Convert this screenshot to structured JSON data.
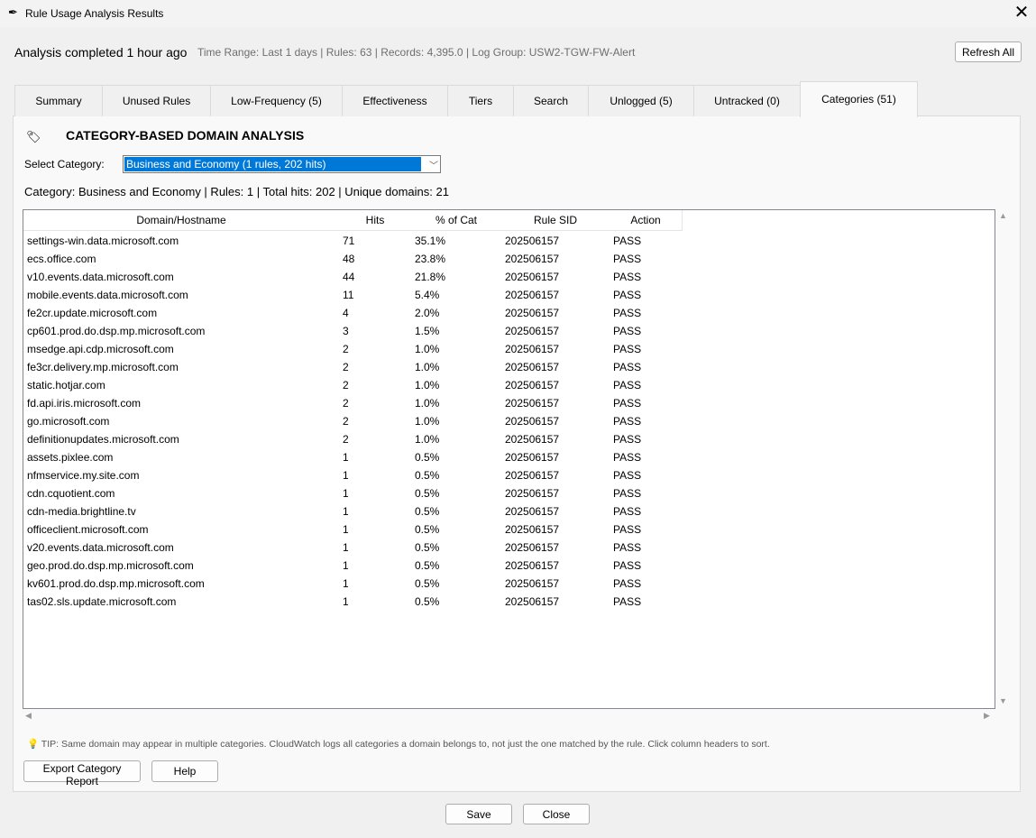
{
  "window": {
    "title": "Rule Usage Analysis Results",
    "app_icon": "feather-icon",
    "close_glyph": "✕"
  },
  "header": {
    "status": "Analysis completed 1 hour ago",
    "meta": "Time Range: Last 1 days | Rules: 63 | Records: 4,395.0 | Log Group: USW2-TGW-FW-Alert",
    "refresh_label": "Refresh All"
  },
  "tabs": [
    {
      "label": "Summary"
    },
    {
      "label": "Unused Rules"
    },
    {
      "label": "Low-Frequency (5)"
    },
    {
      "label": "Effectiveness"
    },
    {
      "label": "Tiers"
    },
    {
      "label": "Search"
    },
    {
      "label": "Unlogged (5)"
    },
    {
      "label": "Untracked (0)"
    },
    {
      "label": "Categories (51)"
    }
  ],
  "active_tab": "Categories (51)",
  "section": {
    "icon_glyph": "🏷",
    "title": "CATEGORY-BASED DOMAIN ANALYSIS",
    "select_label": "Select Category:",
    "select_value": "Business and Economy (1 rules, 202 hits)",
    "summary": "Category: Business and Economy  |  Rules: 1  |  Total hits: 202  |  Unique domains: 21"
  },
  "table": {
    "columns": [
      "Domain/Hostname",
      "Hits",
      "% of Cat",
      "Rule SID",
      "Action"
    ],
    "rows": [
      [
        "settings-win.data.microsoft.com",
        "71",
        "35.1%",
        "202506157",
        "PASS"
      ],
      [
        "ecs.office.com",
        "48",
        "23.8%",
        "202506157",
        "PASS"
      ],
      [
        "v10.events.data.microsoft.com",
        "44",
        "21.8%",
        "202506157",
        "PASS"
      ],
      [
        "mobile.events.data.microsoft.com",
        "11",
        "5.4%",
        "202506157",
        "PASS"
      ],
      [
        "fe2cr.update.microsoft.com",
        "4",
        "2.0%",
        "202506157",
        "PASS"
      ],
      [
        "cp601.prod.do.dsp.mp.microsoft.com",
        "3",
        "1.5%",
        "202506157",
        "PASS"
      ],
      [
        "msedge.api.cdp.microsoft.com",
        "2",
        "1.0%",
        "202506157",
        "PASS"
      ],
      [
        "fe3cr.delivery.mp.microsoft.com",
        "2",
        "1.0%",
        "202506157",
        "PASS"
      ],
      [
        "static.hotjar.com",
        "2",
        "1.0%",
        "202506157",
        "PASS"
      ],
      [
        "fd.api.iris.microsoft.com",
        "2",
        "1.0%",
        "202506157",
        "PASS"
      ],
      [
        "go.microsoft.com",
        "2",
        "1.0%",
        "202506157",
        "PASS"
      ],
      [
        "definitionupdates.microsoft.com",
        "2",
        "1.0%",
        "202506157",
        "PASS"
      ],
      [
        "assets.pixlee.com",
        "1",
        "0.5%",
        "202506157",
        "PASS"
      ],
      [
        "nfmservice.my.site.com",
        "1",
        "0.5%",
        "202506157",
        "PASS"
      ],
      [
        "cdn.cquotient.com",
        "1",
        "0.5%",
        "202506157",
        "PASS"
      ],
      [
        "cdn-media.brightline.tv",
        "1",
        "0.5%",
        "202506157",
        "PASS"
      ],
      [
        "officeclient.microsoft.com",
        "1",
        "0.5%",
        "202506157",
        "PASS"
      ],
      [
        "v20.events.data.microsoft.com",
        "1",
        "0.5%",
        "202506157",
        "PASS"
      ],
      [
        "geo.prod.do.dsp.mp.microsoft.com",
        "1",
        "0.5%",
        "202506157",
        "PASS"
      ],
      [
        "kv601.prod.do.dsp.mp.microsoft.com",
        "1",
        "0.5%",
        "202506157",
        "PASS"
      ],
      [
        "tas02.sls.update.microsoft.com",
        "1",
        "0.5%",
        "202506157",
        "PASS"
      ]
    ]
  },
  "tip": "💡 TIP: Same domain may appear in multiple categories. CloudWatch logs all categories a domain belongs to, not just the one matched by the rule. Click column headers to sort.",
  "buttons": {
    "export": "Export Category Report",
    "help": "Help",
    "save": "Save",
    "close": "Close"
  },
  "colors": {
    "accent": "#0078d7",
    "window_bg": "#f0f0f0",
    "panel_bg": "#f9f9f9"
  }
}
